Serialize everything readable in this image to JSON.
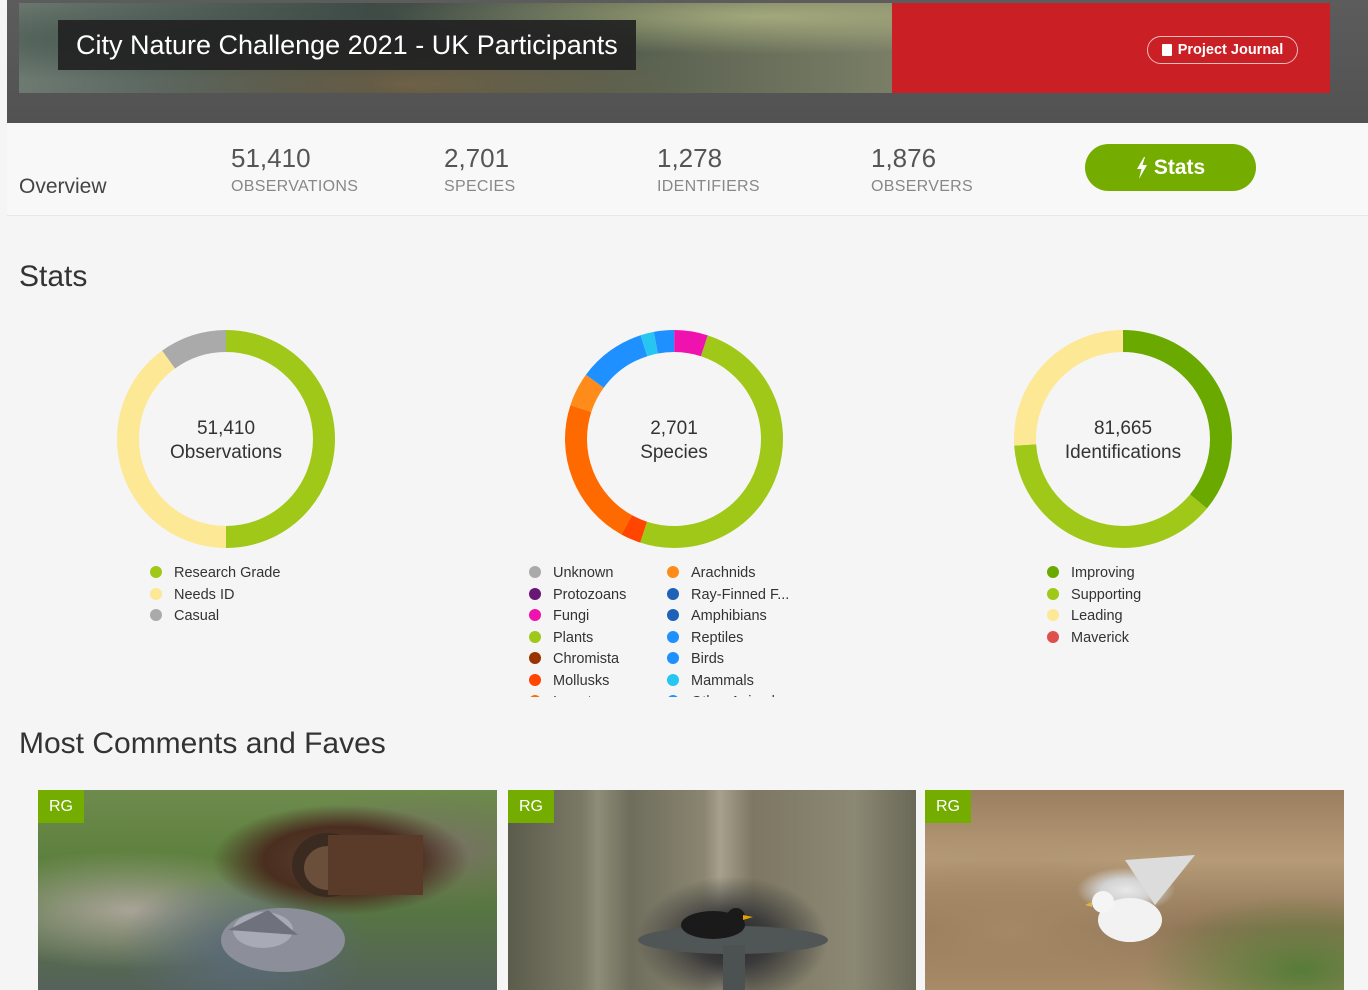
{
  "banner": {
    "title": "City Nature Challenge 2021 - UK Participants",
    "journal_label": "Project Journal",
    "accent_color": "#c91f25"
  },
  "overview": {
    "tab_label": "Overview",
    "stats": [
      {
        "value": "51,410",
        "label": "OBSERVATIONS"
      },
      {
        "value": "2,701",
        "label": "SPECIES"
      },
      {
        "value": "1,278",
        "label": "IDENTIFIERS"
      },
      {
        "value": "1,876",
        "label": "OBSERVERS"
      }
    ],
    "stats_button": "Stats",
    "button_color": "#74ac00"
  },
  "stats": {
    "heading": "Stats",
    "observations": {
      "value": "51,410",
      "label": "Observations",
      "segments": [
        {
          "name": "Research Grade",
          "color": "#a0c818",
          "fraction": 0.5
        },
        {
          "name": "Needs ID",
          "color": "#fde896",
          "fraction": 0.4
        },
        {
          "name": "Casual",
          "color": "#aaaaaa",
          "fraction": 0.1
        }
      ]
    },
    "species": {
      "value": "2,701",
      "label": "Species",
      "segments": [
        {
          "name": "Unknown",
          "color": "#aaaaaa",
          "fraction": 0.0
        },
        {
          "name": "Protozoans",
          "color": "#691776",
          "fraction": 0.0
        },
        {
          "name": "Fungi",
          "color": "#f012ae",
          "fraction": 0.05
        },
        {
          "name": "Plants",
          "color": "#a0c818",
          "fraction": 0.5
        },
        {
          "name": "Chromista",
          "color": "#993300",
          "fraction": 0.0
        },
        {
          "name": "Mollusks",
          "color": "#ff4500",
          "fraction": 0.03
        },
        {
          "name": "Insects",
          "color": "#ff6a00",
          "fraction": 0.22
        },
        {
          "name": "Arachnids",
          "color": "#ff8c1a",
          "fraction": 0.05
        },
        {
          "name": "Ray-Finned F...",
          "color": "#1e62b8",
          "fraction": 0.0
        },
        {
          "name": "Amphibians",
          "color": "#1e62b8",
          "fraction": 0.0
        },
        {
          "name": "Reptiles",
          "color": "#1e90ff",
          "fraction": 0.0
        },
        {
          "name": "Birds",
          "color": "#1e90ff",
          "fraction": 0.1
        },
        {
          "name": "Mammals",
          "color": "#26c6f0",
          "fraction": 0.02
        },
        {
          "name": "Other Animals",
          "color": "#1e90ff",
          "fraction": 0.03
        }
      ]
    },
    "identifications": {
      "value": "81,665",
      "label": "Identifications",
      "segments": [
        {
          "name": "Improving",
          "color": "#6aaa00",
          "fraction": 0.36
        },
        {
          "name": "Supporting",
          "color": "#a0c818",
          "fraction": 0.38
        },
        {
          "name": "Leading",
          "color": "#fde896",
          "fraction": 0.26
        },
        {
          "name": "Maverick",
          "color": "#e04e4e",
          "fraction": 0.0
        }
      ]
    }
  },
  "most_comments": {
    "heading": "Most Comments and Faves",
    "photos": [
      {
        "badge": "RG"
      },
      {
        "badge": "RG"
      },
      {
        "badge": "RG"
      }
    ]
  }
}
